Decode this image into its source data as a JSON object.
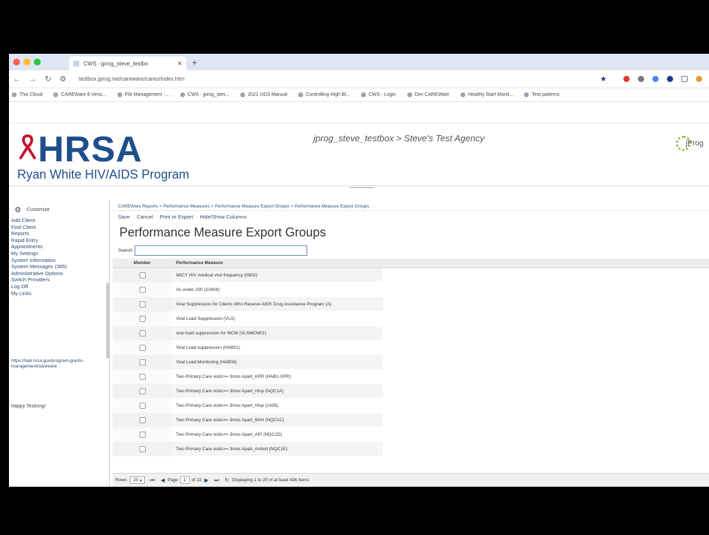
{
  "browser": {
    "tab_title": "CWS - jprog_steve_testbo",
    "url": "testbox.jprog.net/careware/cares/index.htm",
    "bookmarks": [
      "This Cloud",
      "CAREWare 6 Versi...",
      "File Management -...",
      "CWS - jprog_stev...",
      "2021 UDS Manual",
      "Controlling High Bl...",
      "CWS - Login",
      "Dev CAREWare",
      "Healthy Start Monit...",
      "Test patterns"
    ]
  },
  "header": {
    "logo_word": "HRSA",
    "logo_sub": "Ryan White HIV/AIDS Program",
    "context": "jprog_steve_testbox > Steve's Test Agency",
    "brand": "jProg"
  },
  "sidebar": {
    "customize": "Customize",
    "items": [
      "Add Client",
      "Find Client",
      "Reports",
      "Rapid Entry",
      "Appointments",
      "My Settings",
      "System Information",
      "System Messages (385)",
      "Administrative Options",
      "Switch Providers",
      "Log Off",
      "My Links"
    ],
    "link_text": "https://hab.hrsa.gov/program-grants-management/careware",
    "note": "Happy Testinng!"
  },
  "main": {
    "breadcrumb": "CAREWare Reports > Performance Measures > Performance Measure Export Groups > Performance Measure Export Groups",
    "toolbar": [
      "Save",
      "Cancel",
      "Print or Export",
      "Hide/Show Columns"
    ],
    "title": "Performance Measure Export Groups",
    "search_label": "Search:",
    "columns": [
      "Member",
      "Performance Measure"
    ],
    "rows": [
      "WICY HIV medical visit frequency (0902)",
      "VL under 200 (23404)",
      "Viral Suppression for Clients Who Receive AIDS Drug Assistance Program (A)",
      "Viral Load Suppression (VLS)",
      "viral load suppression for MCM (VLSMCM01)",
      "Viral Load suppression (HAB01)",
      "Viral Load Monitoring (HAB08)",
      "Two Primary Care visits>= 3mos Apart_KPR (HAB1-XPR)",
      "Two Primary Care visits>= 3mos Apart_Hisp (NQC1A)",
      "Two Primary Care visits>= 3mos Apart_Hisp (1426)",
      "Two Primary Care visits>= 3mos Apart_BAH (NQC1C)",
      "Two Primary Care visits>= 3mos Apart_API (NQC1D)",
      "Two Primary Care visits>= 3mos Apart_AmInd (NQC1E)"
    ],
    "pager": {
      "rows_label": "Rows:",
      "rows_value": "20",
      "page_label": "Page",
      "page_value": "1",
      "of_label": "of 22",
      "displaying": "Displaying 1 to 20 of at least 436 items"
    }
  },
  "colors": {
    "accent": "#1f4e8c",
    "ribbon": "#c8102e",
    "link": "#2b4a7a"
  }
}
